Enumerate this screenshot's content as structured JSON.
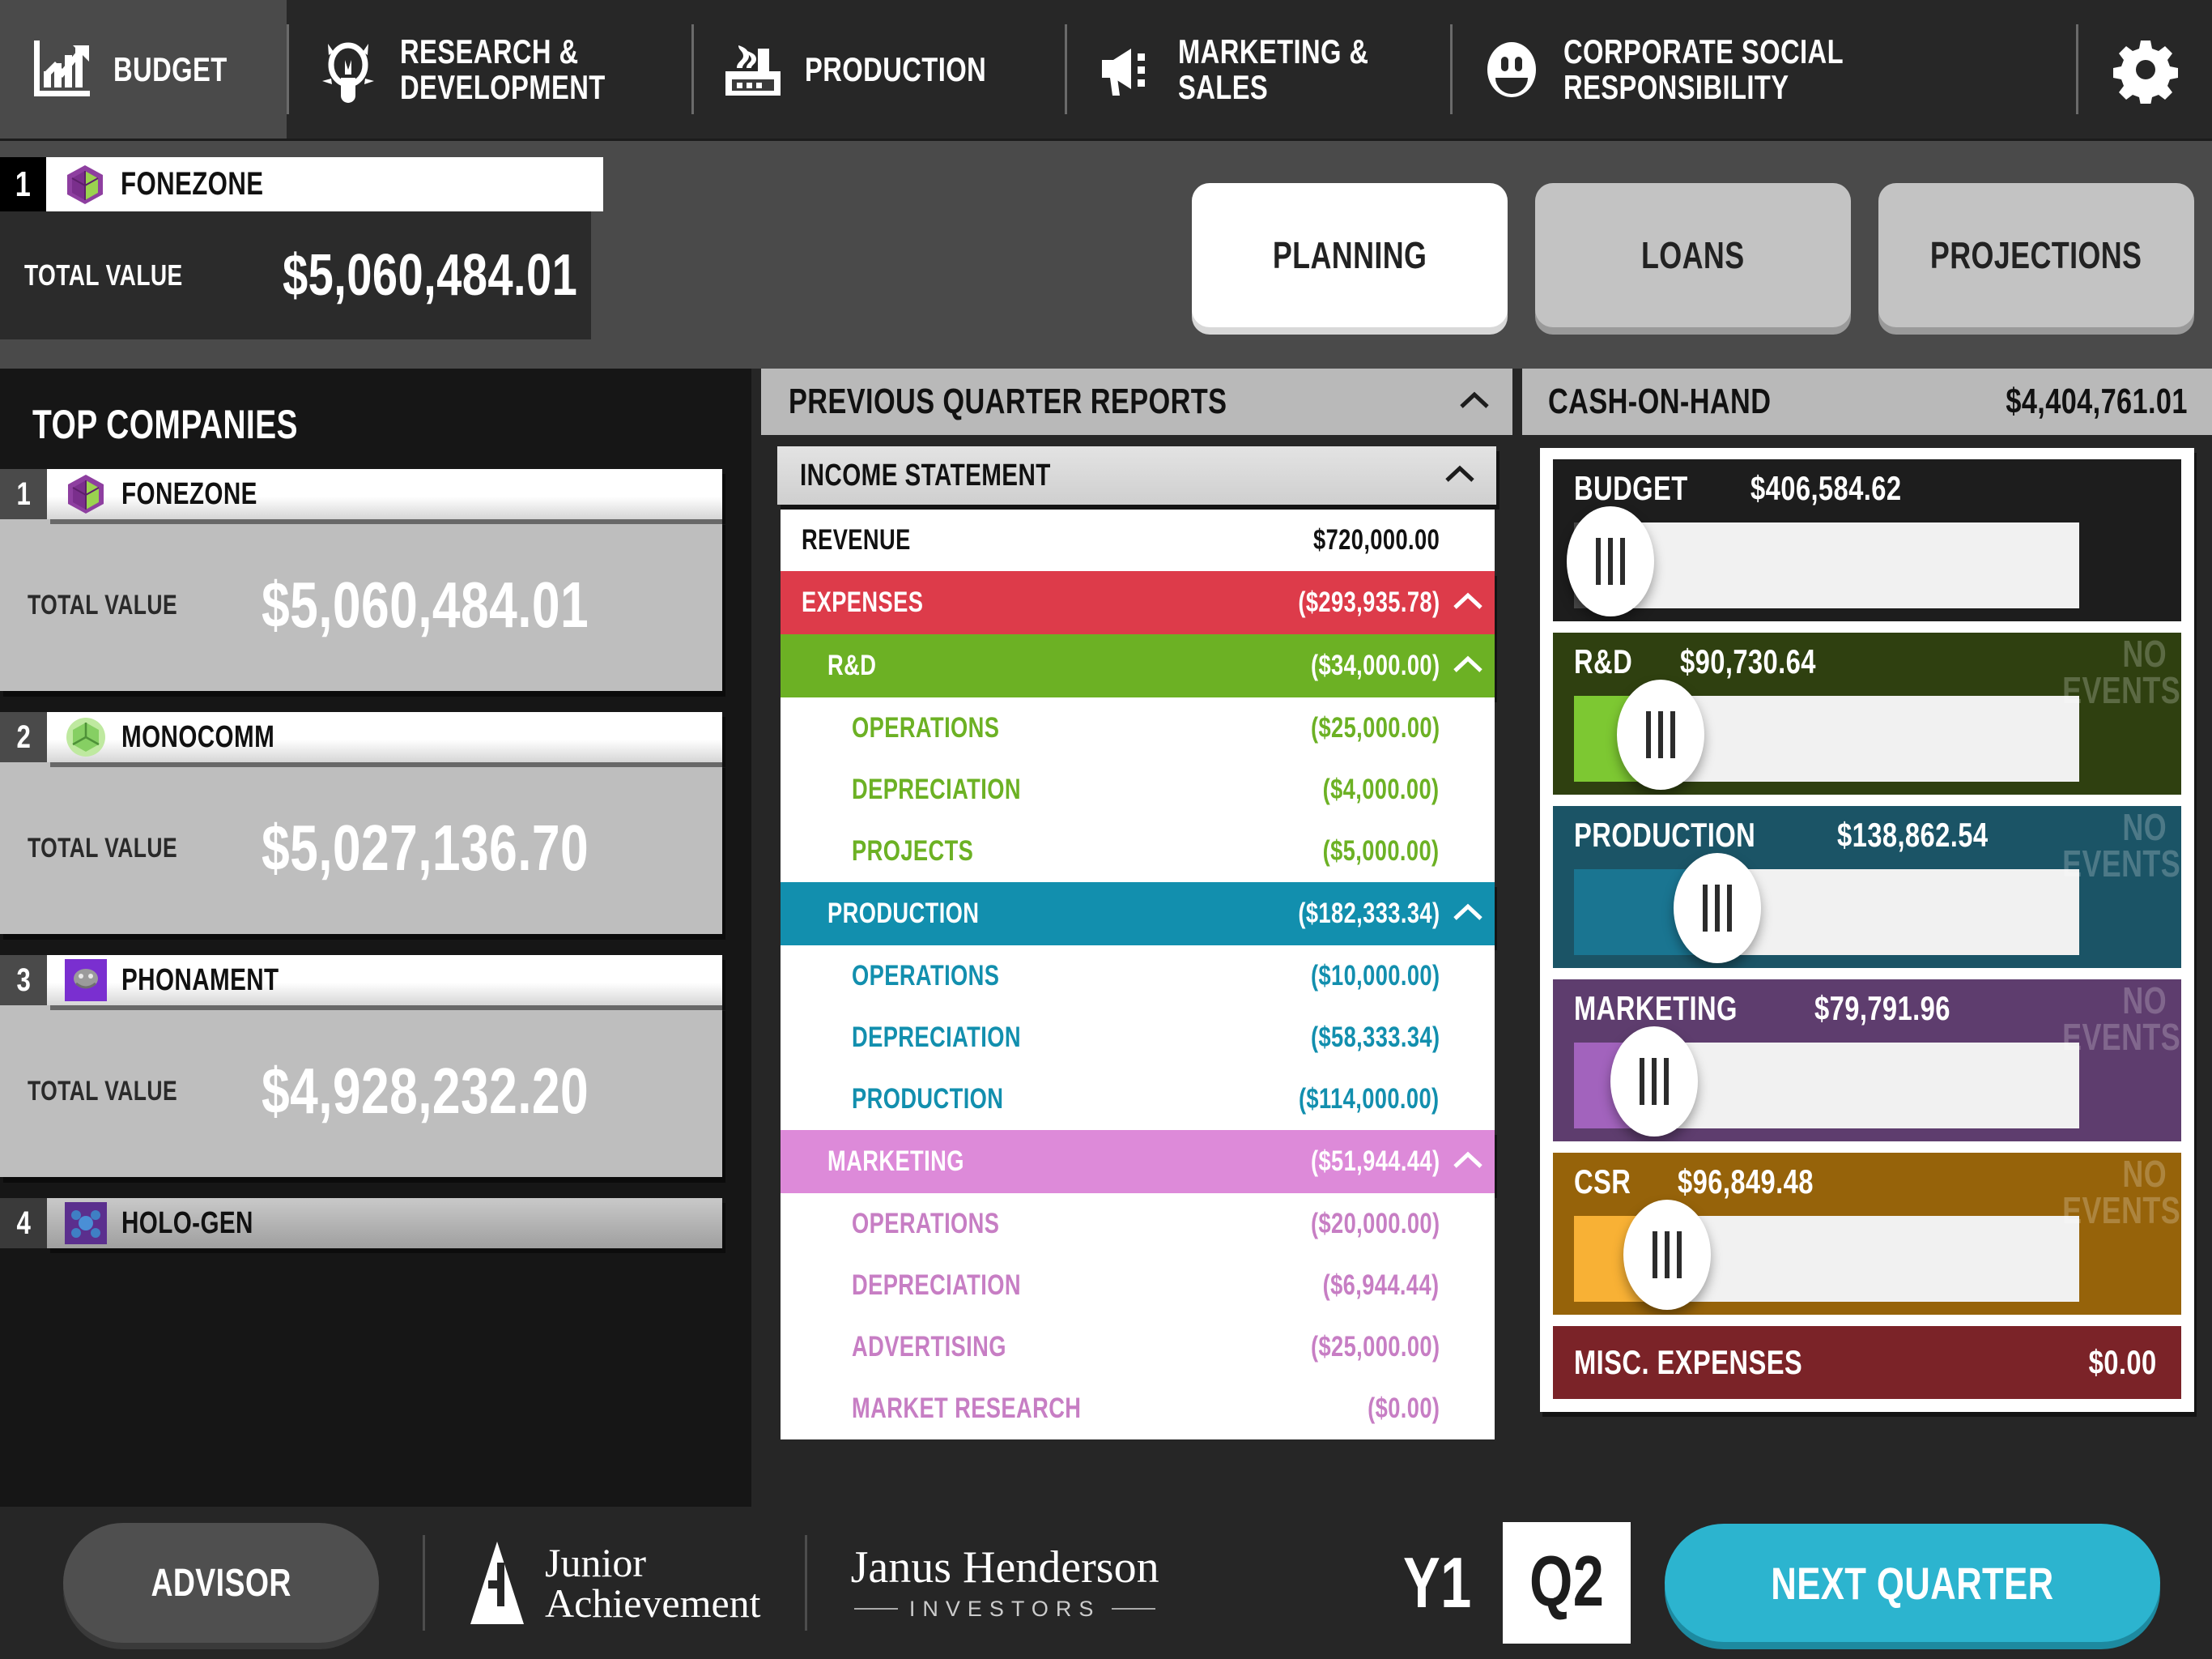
{
  "topnav": {
    "tabs": [
      {
        "label_line1": "BUDGET",
        "label_line2": "",
        "icon": "bar-chart-growth-icon",
        "active": true
      },
      {
        "label_line1": "RESEARCH &",
        "label_line2": "DEVELOPMENT",
        "icon": "lightbulb-icon",
        "active": false
      },
      {
        "label_line1": "PRODUCTION",
        "label_line2": "",
        "icon": "factory-icon",
        "active": false
      },
      {
        "label_line1": "MARKETING &",
        "label_line2": "SALES",
        "icon": "megaphone-icon",
        "active": false
      },
      {
        "label_line1": "CORPORATE SOCIAL",
        "label_line2": "RESPONSIBILITY",
        "icon": "smiley-face-icon",
        "active": false
      }
    ],
    "settings_icon": "gear-icon"
  },
  "player": {
    "rank": "1",
    "company": "FONEZONE",
    "logo": "fonezone-cube-icon",
    "total_value_label": "TOTAL VALUE",
    "total_value": "$5,060,484.01"
  },
  "mode_buttons": [
    {
      "label": "PLANNING",
      "active": true
    },
    {
      "label": "LOANS",
      "active": false
    },
    {
      "label": "PROJECTIONS",
      "active": false
    }
  ],
  "top_companies": {
    "title": "TOP COMPANIES",
    "total_value_label": "TOTAL VALUE",
    "items": [
      {
        "rank": "1",
        "name": "FONEZONE",
        "logo": "fonezone-cube-icon",
        "value": "$5,060,484.01"
      },
      {
        "rank": "2",
        "name": "MONOCOMM",
        "logo": "monocomm-cube-icon",
        "value": "$5,027,136.70"
      },
      {
        "rank": "3",
        "name": "PHONAMENT",
        "logo": "phonament-icon",
        "value": "$4,928,232.20"
      },
      {
        "rank": "4",
        "name": "HOLO-GEN",
        "logo": "hologen-icon",
        "value": ""
      }
    ]
  },
  "reports": {
    "title": "PREVIOUS QUARTER REPORTS",
    "collapse_icon": "chevron-up-icon",
    "income_statement": {
      "title": "INCOME STATEMENT",
      "collapse_icon": "chevron-up-icon",
      "lines": [
        {
          "label": "REVENUE",
          "value": "$720,000.00",
          "level": 0,
          "style": "plain",
          "chevron": false
        },
        {
          "label": "EXPENSES",
          "value": "($293,935.78)",
          "level": 0,
          "style": "expenses",
          "chevron": true
        },
        {
          "label": "R&D",
          "value": "($34,000.00)",
          "level": 1,
          "style": "rd",
          "chevron": true
        },
        {
          "label": "OPERATIONS",
          "value": "($25,000.00)",
          "level": 2,
          "style": "rd-sub",
          "chevron": false
        },
        {
          "label": "DEPRECIATION",
          "value": "($4,000.00)",
          "level": 2,
          "style": "rd-sub",
          "chevron": false
        },
        {
          "label": "PROJECTS",
          "value": "($5,000.00)",
          "level": 2,
          "style": "rd-sub",
          "chevron": false
        },
        {
          "label": "PRODUCTION",
          "value": "($182,333.34)",
          "level": 1,
          "style": "prod",
          "chevron": true
        },
        {
          "label": "OPERATIONS",
          "value": "($10,000.00)",
          "level": 2,
          "style": "prod-sub",
          "chevron": false
        },
        {
          "label": "DEPRECIATION",
          "value": "($58,333.34)",
          "level": 2,
          "style": "prod-sub",
          "chevron": false
        },
        {
          "label": "PRODUCTION",
          "value": "($114,000.00)",
          "level": 2,
          "style": "prod-sub",
          "chevron": false
        },
        {
          "label": "MARKETING",
          "value": "($51,944.44)",
          "level": 1,
          "style": "mkt",
          "chevron": true
        },
        {
          "label": "OPERATIONS",
          "value": "($20,000.00)",
          "level": 2,
          "style": "mkt-sub",
          "chevron": false
        },
        {
          "label": "DEPRECIATION",
          "value": "($6,944.44)",
          "level": 2,
          "style": "mkt-sub",
          "chevron": false
        },
        {
          "label": "ADVERTISING",
          "value": "($25,000.00)",
          "level": 2,
          "style": "mkt-sub",
          "chevron": false
        },
        {
          "label": "MARKET RESEARCH",
          "value": "($0.00)",
          "level": 2,
          "style": "mkt-sub",
          "chevron": false
        }
      ]
    }
  },
  "cash_panel": {
    "label": "CASH-ON-HAND",
    "value": "$4,404,761.01",
    "no_events_text": "NO EVENTS",
    "sliders": [
      {
        "name": "BUDGET",
        "amount": "$406,584.62",
        "fill_pct": 4,
        "knob_pct": 4,
        "bg": "#1d1d1d",
        "fill": "#4a4a4a",
        "events": false,
        "flat": false
      },
      {
        "name": "R&D",
        "amount": "$90,730.64",
        "fill_pct": 15,
        "knob_pct": 12,
        "bg": "#2f4010",
        "fill": "#7dc832",
        "events": true,
        "flat": false
      },
      {
        "name": "PRODUCTION",
        "amount": "$138,862.54",
        "fill_pct": 24,
        "knob_pct": 21,
        "bg": "#1b5466",
        "fill": "#1a7591",
        "events": true,
        "flat": false
      },
      {
        "name": "MARKETING",
        "amount": "$79,791.96",
        "fill_pct": 13,
        "knob_pct": 11,
        "bg": "#5e3d6e",
        "fill": "#a263bd",
        "events": true,
        "flat": false
      },
      {
        "name": "CSR",
        "amount": "$96,849.48",
        "fill_pct": 16,
        "knob_pct": 13,
        "bg": "#96630a",
        "fill": "#f8b135",
        "events": true,
        "flat": false
      },
      {
        "name": "MISC. EXPENSES",
        "amount": "$0.00",
        "fill_pct": 0,
        "knob_pct": 0,
        "bg": "#7b2328",
        "fill": "#7b2328",
        "events": false,
        "flat": true
      }
    ]
  },
  "bottom": {
    "advisor_label": "ADVISOR",
    "ja_logo_line1": "Junior",
    "ja_logo_line2": "Achievement",
    "ja_logo_mark": "ja-triangle-icon",
    "jh_logo_line1": "Janus Henderson",
    "jh_logo_line2": "INVESTORS",
    "year": "Y1",
    "quarter": "Q2",
    "next_quarter_label": "NEXT QUARTER"
  },
  "colors": {
    "expenses": "#dd3b4a",
    "rd": "#6cb124",
    "production": "#128fae",
    "marketing": "#dd8ad9",
    "accent_teal": "#2cb4cf"
  }
}
